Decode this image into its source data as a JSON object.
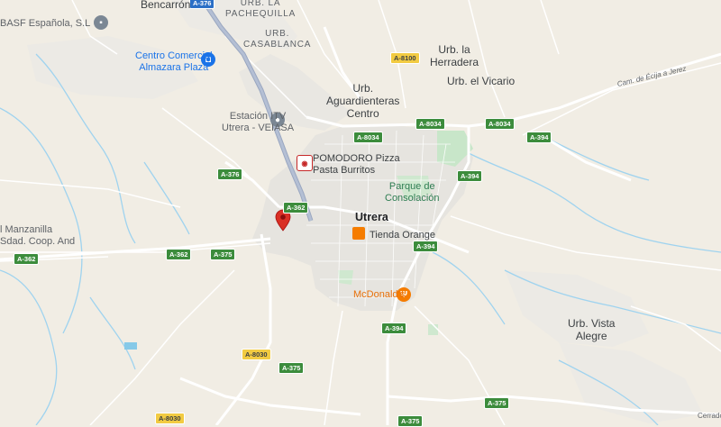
{
  "labels": {
    "bencarron": "Bencarrón",
    "basf": "BASF Española, S.L",
    "urb_la_pachequilla": "URB. LA\nPACHEQUILLA",
    "urb_casablanca": "URB.\nCASABLANCA",
    "centro_comercial": "Centro Comercial\nAlmazara Plaza",
    "urb_la_herradera": "Urb. la\nHerradera",
    "urb_el_vicario": "Urb. el Vicario",
    "urb_aguardienteras": "Urb.\nAguardienteras\nCentro",
    "estacion_itv": "Estación ITV\nUtrera - VEIASA",
    "pomodoro": "POMODORO Pizza\nPasta Burritos",
    "parque": "Parque de\nConsolación",
    "utrera": "Utrera",
    "tienda_orange": "Tienda Orange",
    "mcdonalds": "McDonald's",
    "manzanilla": "l Manzanilla\nSdad. Coop. And",
    "urb_vista_alegre": "Urb. Vista\nAlegre",
    "camino": "Cam. de Écija a Jerez",
    "cerrado": "Cerrado"
  },
  "shields": {
    "a376_top": "A-376",
    "a8100": "A-8100",
    "a8034_a": "A-8034",
    "a8034_b": "A-8034",
    "a8034_c": "A-8034",
    "a394_a": "A-394",
    "a394_b": "A-394",
    "a394_c": "A-394",
    "a394_d": "A-394",
    "a376": "A-376",
    "a362_a": "A-362",
    "a362_b": "A-362",
    "a362_c": "A-362",
    "a375_a": "A-375",
    "a375_b": "A-375",
    "a375_c": "A-375",
    "a375_d": "A-375",
    "a8030_a": "A-8030",
    "a8030_b": "A-8030"
  },
  "colors": {
    "land": "#f1ede4",
    "urban": "#e8e6e1",
    "park": "#c8e6c9",
    "water": "#86c9e8",
    "road": "#ffffff",
    "highway": "#aab4c8",
    "pin": "#d93025",
    "orange": "#f57c00"
  },
  "icons": {
    "pin": "location-pin-icon",
    "basf": "factory-icon",
    "shopping": "shopping-bag-icon",
    "itv": "car-service-icon",
    "pomodoro": "restaurant-logo-icon",
    "orange": "store-icon",
    "mcdonalds": "fork-knife-icon"
  }
}
